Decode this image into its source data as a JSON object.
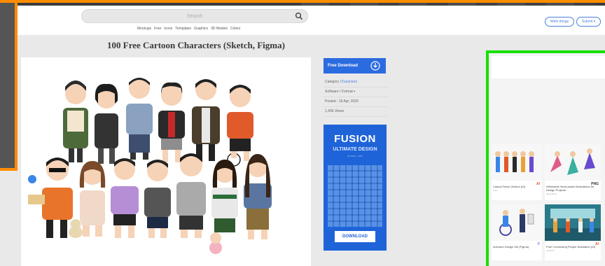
{
  "header": {
    "search_placeholder": "Search",
    "categories": [
      "Mockups",
      "Free",
      "Icons",
      "Templates",
      "Graphics",
      "3D Models",
      "Colors"
    ],
    "write_label": "Write things",
    "submit_label": "Submit ▾"
  },
  "page": {
    "title": "100 Free Cartoon Characters (Sketch, Figma)"
  },
  "sidebar": {
    "download_label": "Free Download",
    "meta": [
      {
        "label": "Category",
        "value": "Characters"
      },
      {
        "label": "Software / Format",
        "value": ""
      },
      {
        "label": "Posted :",
        "value": "19 Apr, 2020"
      },
      {
        "label": "",
        "value": "1,406 Views"
      }
    ]
  },
  "ad": {
    "title": "FUSION",
    "subtitle": "ULTIMATE DESIGN",
    "tiny": "BUNDLE · 2020",
    "button": "DOWNLOAD"
  },
  "related": [
    {
      "title": "Casual Teens Vectors (AI)",
      "sub": "Free",
      "badge": "AI",
      "badge_color": "#e05a2b"
    },
    {
      "title": "Whimsical Hand-drawn Illustrations for Design Projects",
      "sub": "Illustrations",
      "badge": "PNG",
      "badge_color": "#333333"
    },
    {
      "title": "Inclusive Design Set (Figma)",
      "sub": "",
      "badge": "F",
      "badge_color": "#a259ff"
    },
    {
      "title": "Free Commuting People Illustration (AI)",
      "sub": "Graphics",
      "badge": "AI",
      "badge_color": "#e05a2b"
    }
  ],
  "colors": {
    "accent": "#2b6be0",
    "orange_highlight": "#ff8c00",
    "green_highlight": "#17e000"
  }
}
